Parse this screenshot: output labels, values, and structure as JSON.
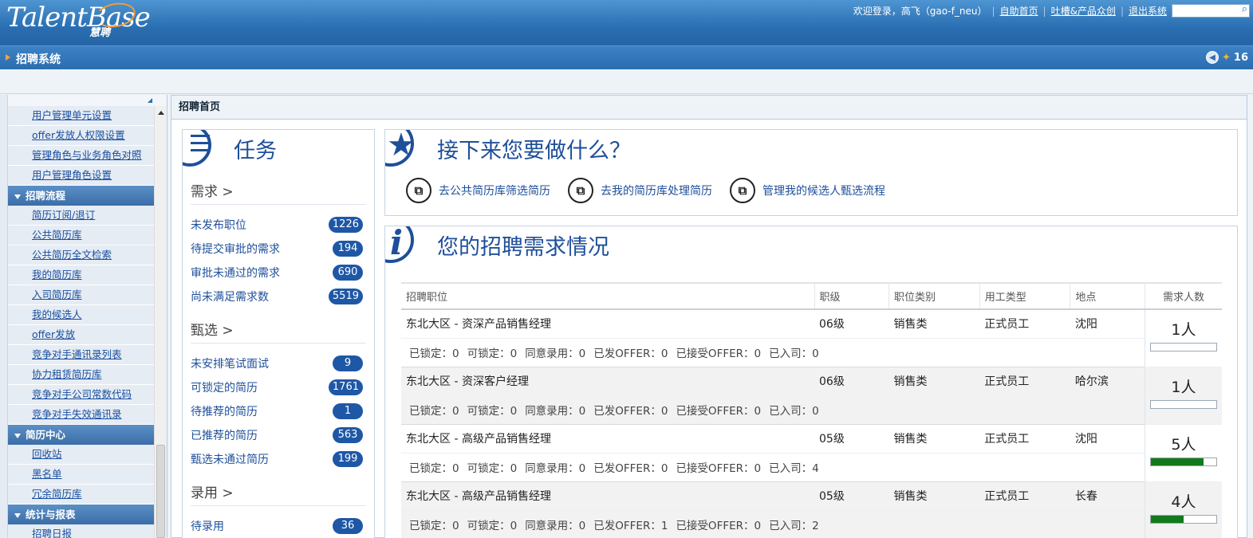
{
  "header": {
    "logo": "TalentBase",
    "logo_sub": "慧聘",
    "welcome": "欢迎登录，高飞（gao-f_neu）",
    "links": [
      "自助首页",
      "吐槽&产品众创",
      "退出系统"
    ],
    "search_placeholder": ""
  },
  "navbar": {
    "title": "招聘系统",
    "count": "16"
  },
  "sidebar": {
    "items": [
      {
        "type": "item",
        "label": "用户管理单元设置"
      },
      {
        "type": "item",
        "label": "offer发放人权限设置"
      },
      {
        "type": "item",
        "label": "管理角色与业务角色对照"
      },
      {
        "type": "item",
        "label": "用户管理角色设置"
      },
      {
        "type": "group",
        "label": "招聘流程"
      },
      {
        "type": "item",
        "label": "简历订阅/退订"
      },
      {
        "type": "item",
        "label": "公共简历库"
      },
      {
        "type": "item",
        "label": "公共简历全文检索"
      },
      {
        "type": "item",
        "label": "我的简历库"
      },
      {
        "type": "item",
        "label": "入司简历库"
      },
      {
        "type": "item",
        "label": "我的候选人"
      },
      {
        "type": "item",
        "label": "offer发放"
      },
      {
        "type": "item",
        "label": "竞争对手通讯录列表"
      },
      {
        "type": "item",
        "label": "协力租赁简历库"
      },
      {
        "type": "item",
        "label": "竞争对手公司常数代码"
      },
      {
        "type": "item",
        "label": "竞争对手失效通讯录"
      },
      {
        "type": "group",
        "label": "简历中心"
      },
      {
        "type": "item",
        "label": "回收站"
      },
      {
        "type": "item",
        "label": "黑名单"
      },
      {
        "type": "item",
        "label": "冗余简历库"
      },
      {
        "type": "group",
        "label": "统计与报表"
      },
      {
        "type": "item",
        "label": "招聘日报"
      }
    ]
  },
  "main": {
    "title": "招聘首页"
  },
  "tasks": {
    "title": "任务",
    "sections": [
      {
        "label": "需求 >",
        "rows": [
          {
            "label": "未发布职位",
            "count": "1226"
          },
          {
            "label": "待提交审批的需求",
            "count": "194"
          },
          {
            "label": "审批未通过的需求",
            "count": "690"
          },
          {
            "label": "尚未满足需求数",
            "count": "5519"
          }
        ]
      },
      {
        "label": "甄选 >",
        "rows": [
          {
            "label": "未安排笔试面试",
            "count": "9"
          },
          {
            "label": "可锁定的简历",
            "count": "1761"
          },
          {
            "label": "待推荐的简历",
            "count": "1"
          },
          {
            "label": "已推荐的简历",
            "count": "563"
          },
          {
            "label": "甄选未通过简历",
            "count": "199"
          }
        ]
      },
      {
        "label": "录用 >",
        "rows": [
          {
            "label": "待录用",
            "count": "36"
          }
        ]
      }
    ]
  },
  "next": {
    "title": "接下来您要做什么？",
    "actions": [
      "去公共简历库筛选简历",
      "去我的简历库处理简历",
      "管理我的候选人甄选流程"
    ]
  },
  "needs": {
    "title": "您的招聘需求情况",
    "columns": [
      "招聘职位",
      "职级",
      "职位类别",
      "用工类型",
      "地点",
      "需求人数"
    ],
    "rows": [
      {
        "position": "东北大区 - 资深产品销售经理",
        "level": "06级",
        "category": "销售类",
        "type": "正式员工",
        "location": "沈阳",
        "count": "1人",
        "fill": 0,
        "stats": [
          "已锁定：0",
          "可锁定：0",
          "同意录用：0",
          "已发OFFER：0",
          "已接受OFFER：0",
          "已入司：0"
        ]
      },
      {
        "position": "东北大区 - 资深客户经理",
        "level": "06级",
        "category": "销售类",
        "type": "正式员工",
        "location": "哈尔滨",
        "count": "1人",
        "fill": 0,
        "stats": [
          "已锁定：0",
          "可锁定：0",
          "同意录用：0",
          "已发OFFER：0",
          "已接受OFFER：0",
          "已入司：0"
        ]
      },
      {
        "position": "东北大区 - 高级产品销售经理",
        "level": "05级",
        "category": "销售类",
        "type": "正式员工",
        "location": "沈阳",
        "count": "5人",
        "fill": 0.8,
        "stats": [
          "已锁定：0",
          "可锁定：0",
          "同意录用：0",
          "已发OFFER：0",
          "已接受OFFER：0",
          "已入司：4"
        ]
      },
      {
        "position": "东北大区 - 高级产品销售经理",
        "level": "05级",
        "category": "销售类",
        "type": "正式员工",
        "location": "长春",
        "count": "4人",
        "fill": 0.5,
        "stats": [
          "已锁定：0",
          "可锁定：0",
          "同意录用：0",
          "已发OFFER：1",
          "已接受OFFER：0",
          "已入司：2"
        ]
      }
    ]
  }
}
